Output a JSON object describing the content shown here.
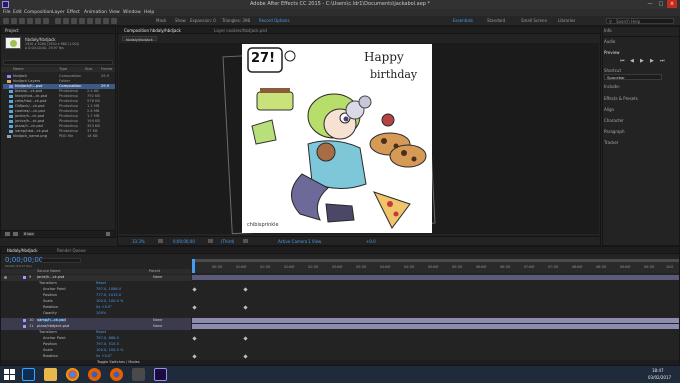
{
  "window": {
    "title": "Adobe After Effects CC 2015 - C:\\Users\\c.ldr1\\Documents\\jackabol.aep *"
  },
  "menu": [
    "File",
    "Edit",
    "Composition",
    "Layer",
    "Effect",
    "Animation",
    "View",
    "Window",
    "Help"
  ],
  "toolbar": {
    "mask_label": "Mask",
    "show_label": "Show",
    "expansion_label": "Expansion: 0",
    "triangles_label": "Triangles: 398",
    "record_label": "Record Options",
    "workspaces": [
      "Essentials",
      "Standard",
      "Small Screen",
      "Libraries"
    ],
    "search_placeholder": "Search Help"
  },
  "project": {
    "tab": "Project",
    "preview_name": "hbdaly/hbdjack",
    "preview_info_1": "1920 x 1080 (1920 x 960 (1.00))",
    "preview_info_2": "Δ 0;00;10;00, 29.97 fps",
    "columns": [
      "Name",
      "Type",
      "Size",
      "Frame"
    ],
    "rows": [
      {
        "name": "hbdjack",
        "type": "Composition",
        "size": "",
        "frame": "29.9"
      },
      {
        "name": "hbdjack Layers",
        "type": "Folder",
        "size": "",
        "frame": ""
      },
      {
        "name": "hbdjack/h...psd",
        "type": "Composition",
        "size": "",
        "frame": "29.9"
      },
      {
        "name": "blabla/...ck.psd",
        "type": "Photoshop",
        "size": "2.4 KB",
        "frame": ""
      },
      {
        "name": "hbdy/hbd...ck.psd",
        "type": "Photoshop",
        "size": "792 KB",
        "frame": ""
      },
      {
        "name": "ceke/hbd...ck.psd",
        "type": "Photoshop",
        "size": "578 KB",
        "frame": ""
      },
      {
        "name": "Cbfjack/...ck.psd",
        "type": "Photoshop",
        "size": "1.2 MB",
        "frame": ""
      },
      {
        "name": "cookies/...ck.psd",
        "type": "Photoshop",
        "size": "2.6 MB",
        "frame": ""
      },
      {
        "name": "jackie/h...ck.psd",
        "type": "Photoshop",
        "size": "1.7 MB",
        "frame": ""
      },
      {
        "name": "janice/h...ck.psd",
        "type": "Photoshop",
        "size": "194 KB",
        "frame": ""
      },
      {
        "name": "pizza/h...ck.psd",
        "type": "Photoshop",
        "size": "353 KB",
        "frame": ""
      },
      {
        "name": "vamp/hbd...ck.psd",
        "type": "Photoshop",
        "size": "37 KB",
        "frame": ""
      },
      {
        "name": "hbdjack_name.png",
        "type": "PNG file",
        "size": "18 KB",
        "frame": ""
      }
    ],
    "bpc": "8 bpc"
  },
  "composition": {
    "tab_label": "Composition hbdaly/hbdjack",
    "layer_tab_label": "Layer cookies/hbdjack.psd",
    "breadcrumb": "hbdaly/hbdjack",
    "art_badge": "27!",
    "art_title_1": "Happy",
    "art_title_2": "birthday",
    "art_signature": "chibisprinkle",
    "zoom": "33.3%",
    "timecode": "0;00;00;00",
    "resolution": "(Third)",
    "camera": "Active Camera",
    "views": "1 View",
    "exposure": "+0.0"
  },
  "right_panel": {
    "items": [
      "Info",
      "Audio",
      "Preview",
      "Shortcut",
      "Spacebar",
      "Include:",
      "Effects & Presets",
      "Align",
      "Character",
      "Paragraph",
      "Tracker"
    ]
  },
  "timeline": {
    "tab_label": "hbdaly/hbdjack",
    "render_tab_label": "Render Queue",
    "timecode": "0;00;00;00",
    "fps": "00000 (29.97 fps)",
    "col_layer": "Source Name",
    "col_parent": "Parent",
    "ruler": [
      "00:15f",
      "01:00f",
      "01:15f",
      "02:00f",
      "02:15f",
      "03:00f",
      "03:15f",
      "04:00f",
      "04:15f",
      "05:00f",
      "05:15f",
      "06:00f",
      "06:15f",
      "07:00f",
      "07:15f",
      "08:00f",
      "08:15f",
      "09:00f",
      "09:15f",
      "10:0"
    ],
    "layers": [
      {
        "num": "9",
        "name": "janie/h...ck.psd",
        "parent": "None"
      },
      {
        "prop": "Transform",
        "value": "Reset"
      },
      {
        "prop": "Anchor Point",
        "value": "797.0, 1086.0"
      },
      {
        "prop": "Position",
        "value": "777.0, 1015.0"
      },
      {
        "prop": "Scale",
        "value": "100.0, 100.0 %"
      },
      {
        "prop": "Rotation",
        "value": "0x +0.0°"
      },
      {
        "prop": "Opacity",
        "value": "100%"
      },
      {
        "num": "10",
        "name": "vamp/h...ck.psd",
        "parent": "None"
      },
      {
        "num": "11",
        "name": "pizza/hbdjack.psd",
        "parent": "None"
      },
      {
        "prop": "Transform",
        "value": "Reset"
      },
      {
        "prop": "Anchor Point",
        "value": "797.0, 666.0"
      },
      {
        "prop": "Position",
        "value": "797.0, 515.0"
      },
      {
        "prop": "Scale",
        "value": "100.0, 100.0 %"
      },
      {
        "prop": "Rotation",
        "value": "0x +0.0°"
      }
    ],
    "footer": "Toggle Switches / Modes"
  },
  "taskbar": {
    "clock": "18:47",
    "date": "03/02/2017"
  }
}
